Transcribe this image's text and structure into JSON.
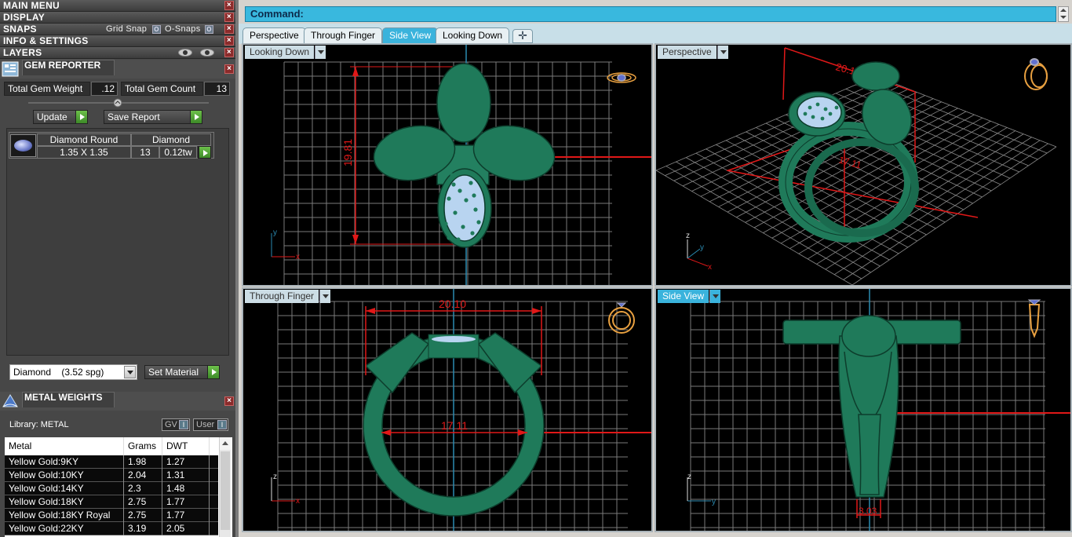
{
  "menu": {
    "main_menu": "MAIN MENU",
    "display": "DISPLAY",
    "snaps": "SNAPS",
    "grid_snap": "Grid Snap",
    "o_snaps": "O-Snaps",
    "info_settings": "INFO & SETTINGS",
    "layers": "LAYERS"
  },
  "gem_reporter": {
    "title": "GEM REPORTER",
    "total_weight_label": "Total Gem Weight",
    "total_weight_value": ".12",
    "total_count_label": "Total Gem Count",
    "total_count_value": "13",
    "update_label": "Update",
    "save_report_label": "Save Report",
    "gem_name": "Diamond Round",
    "gem_size": "1.35 X 1.35",
    "gem_type": "Diamond",
    "gem_count": "13",
    "gem_tw": "0.12tw",
    "material_select": "Diamond    (3.52 spg)",
    "set_material_label": "Set Material"
  },
  "metal_weights": {
    "title": "METAL WEIGHTS",
    "library": "Library: METAL",
    "gv_label": "GV",
    "user_label": "User",
    "headers": [
      "Metal",
      "Grams",
      "DWT"
    ],
    "rows": [
      [
        "Yellow Gold:9KY",
        "1.98",
        "1.27"
      ],
      [
        "Yellow Gold:10KY",
        "2.04",
        "1.31"
      ],
      [
        "Yellow Gold:14KY",
        "2.3",
        "1.48"
      ],
      [
        "Yellow Gold:18KY",
        "2.75",
        "1.77"
      ],
      [
        "Yellow Gold:18KY Royal",
        "2.75",
        "1.77"
      ],
      [
        "Yellow Gold:22KY",
        "3.19",
        "2.05"
      ]
    ]
  },
  "command": {
    "label": "Command:"
  },
  "tabs": [
    "Perspective",
    "Through Finger",
    "Side View",
    "Looking Down"
  ],
  "active_tab": "Side View",
  "viewports": {
    "top_left": {
      "label": "Looking Down",
      "dimension": "19.81",
      "axis_a": "y",
      "axis_b": "x"
    },
    "top_right": {
      "label": "Perspective",
      "dimension_a": "20.10",
      "dimension_b": "17.11",
      "axis_a": "z",
      "axis_b": "y",
      "axis_c": "x"
    },
    "bottom_left": {
      "label": "Through Finger",
      "dimension_a": "20.10",
      "dimension_b": "17.11",
      "axis_a": "z",
      "axis_b": "x"
    },
    "bottom_right": {
      "label": "Side View",
      "dimension": "3.03",
      "axis_a": "z",
      "axis_b": "y"
    }
  },
  "colors": {
    "ring_green": "#1f7a5a",
    "dimension_red": "#e01818",
    "grid": "#808080",
    "accent_blue": "#3ab3dc"
  }
}
